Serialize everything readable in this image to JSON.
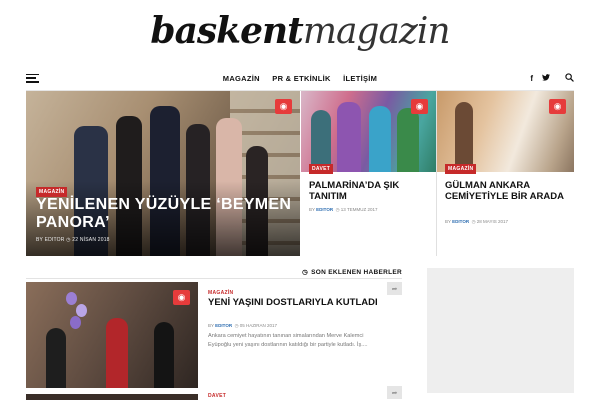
{
  "site": {
    "logo_bold": "baskent",
    "logo_light": "magazin"
  },
  "nav": {
    "menu_icon": "hamburger-menu-icon",
    "links": [
      "MAGAZİN",
      "PR & ETKİNLİK",
      "İLETİŞİM"
    ],
    "social": {
      "facebook": "f",
      "twitter": "𝕥"
    },
    "search_icon": "search-icon"
  },
  "featured": {
    "main": {
      "category": "MAGAZİN",
      "title": "YENİLENEN YÜZÜYLE ‘BEYMEN PANORA’",
      "meta": "BY EDITOR  ◷ 22 NİSAN 2018"
    },
    "side1": {
      "category": "DAVET",
      "title": "PALMARİNA’DA ŞIK TANITIM",
      "author": "EDITOR",
      "date": "13 TEMMUZ 2017"
    },
    "side2": {
      "category": "MAGAZİN",
      "title": "GÜLMAN ANKARA CEMİYETİYLE BİR ARADA",
      "author": "EDITOR",
      "date": "28 MAYIS 2017"
    }
  },
  "latest": {
    "heading": "SON EKLENEN HABERLER",
    "posts": [
      {
        "category": "MAGAZİN",
        "title": "YENİ YAŞINI DOSTLARIYLA KUTLADI",
        "author": "EDITOR",
        "date": "05 HAZIRAN 2017",
        "excerpt": "Ankara cemiyet hayatının tanınan simalarından Merve Kalemci Eyüpoğlu yeni yaşını dostlarının katıldığı bir partiyle kutladı. İş...."
      },
      {
        "category": "DAVET"
      }
    ]
  },
  "colors": {
    "accent_red": "#c62a2a",
    "camera_red": "#e63b3b",
    "author_blue": "#2b6cb0"
  }
}
